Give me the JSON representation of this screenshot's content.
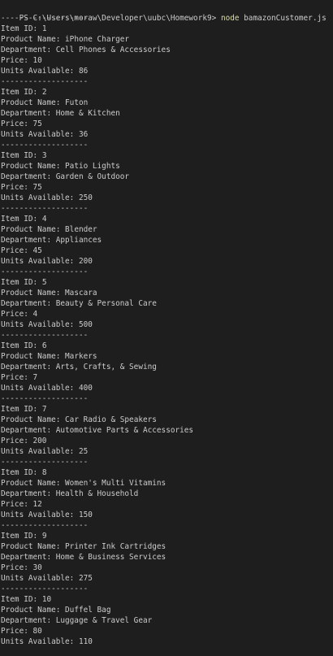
{
  "terminal": {
    "prompt": {
      "path": "PS C:\\Users\\moraw\\Developer\\uubc\\Homework9> ",
      "command": "node",
      "argument": " bamazonCustomer.js"
    },
    "separator": "-------------------",
    "labels": {
      "id": "Item ID: ",
      "name": "Product Name: ",
      "department": "Department: ",
      "price": "Price: ",
      "units": "Units Available: "
    },
    "products": [
      {
        "id": "1",
        "name": "iPhone Charger",
        "department": "Cell Phones & Accessories",
        "price": "10",
        "units": "86"
      },
      {
        "id": "2",
        "name": "Futon",
        "department": "Home & Kitchen",
        "price": "75",
        "units": "36"
      },
      {
        "id": "3",
        "name": "Patio Lights",
        "department": "Garden & Outdoor",
        "price": "75",
        "units": "250"
      },
      {
        "id": "4",
        "name": "Blender",
        "department": "Appliances",
        "price": "45",
        "units": "200"
      },
      {
        "id": "5",
        "name": "Mascara",
        "department": "Beauty & Personal Care",
        "price": "4",
        "units": "500"
      },
      {
        "id": "6",
        "name": "Markers",
        "department": "Arts, Crafts, & Sewing",
        "price": "7",
        "units": "400"
      },
      {
        "id": "7",
        "name": "Car Radio & Speakers",
        "department": "Automotive Parts & Accessories",
        "price": "200",
        "units": "25"
      },
      {
        "id": "8",
        "name": "Women's Multi Vitamins",
        "department": "Health & Household",
        "price": "12",
        "units": "150"
      },
      {
        "id": "9",
        "name": "Printer Ink Cartridges",
        "department": "Home & Business Services",
        "price": "30",
        "units": "275"
      },
      {
        "id": "10",
        "name": "Duffel Bag",
        "department": "Luggage & Travel Gear",
        "price": "80",
        "units": "110"
      }
    ]
  }
}
